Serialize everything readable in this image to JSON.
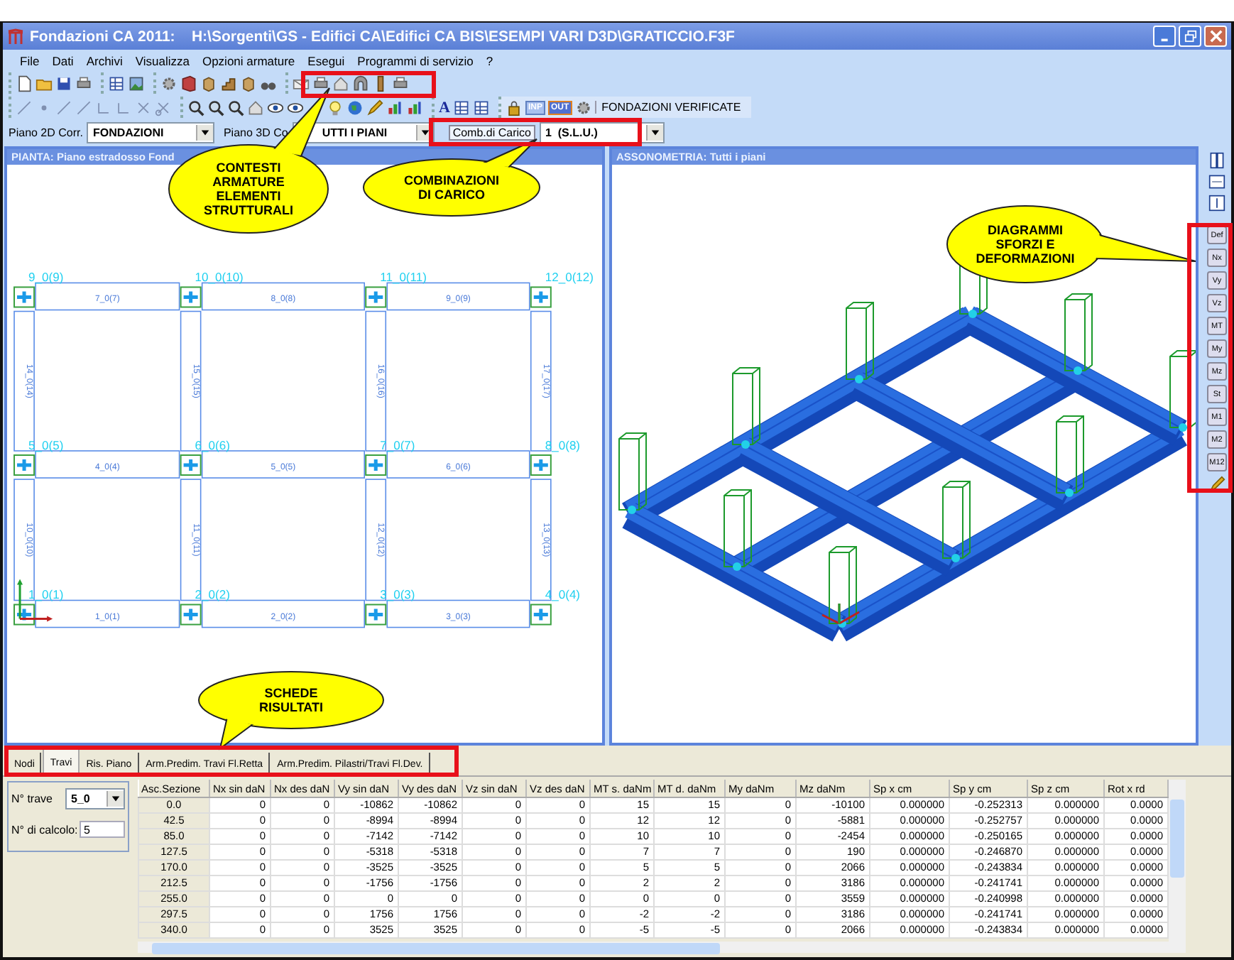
{
  "window": {
    "title": "Fondazioni CA 2011:    H:\\Sorgenti\\GS - Edifici CA\\Edifici CA BIS\\ESEMPI VARI D3D\\GRATICCIO.F3F"
  },
  "menu": [
    "File",
    "Dati",
    "Archivi",
    "Visualizza",
    "Opzioni armature",
    "Esegui",
    "Programmi di servizio",
    "?"
  ],
  "toolbar": {
    "glyph": "A",
    "toggles": [
      {
        "label": "INP",
        "pressed": false
      },
      {
        "label": "OUT",
        "pressed": true
      }
    ],
    "verified_button": "FONDAZIONI VERIFICATE"
  },
  "selectors": [
    {
      "label": "Piano 2D Corr.",
      "value": "FONDAZIONI"
    },
    {
      "label": "Piano 3D Co",
      "value": "UTTI I PIANI"
    },
    {
      "label": "Comb.di Carico",
      "value": "1  (S.L.U.)"
    }
  ],
  "plan": {
    "title": "PIANTA: Piano estradosso Fond",
    "node_labels": [
      "9_0(9)",
      "10_0(10)",
      "11_0(11)",
      "12_0(12)",
      "5_0(5)",
      "6_0(6)",
      "7_0(7)",
      "8_0(8)",
      "1_0(1)",
      "2_0(2)",
      "3_0(3)",
      "4_0(4)"
    ],
    "horizontal_beam_labels": [
      "7_0(7)",
      "8_0(8)",
      "9_0(9)",
      "4_0(4)",
      "5_0(5)",
      "6_0(6)",
      "1_0(1)",
      "2_0(2)",
      "3_0(3)"
    ],
    "vertical_beam_labels": [
      "14_0(14)",
      "15_0(15)",
      "16_0(16)",
      "17_0(17)",
      "10_0(10)",
      "11_0(11)",
      "12_0(12)",
      "13_0(13)"
    ]
  },
  "axonometry": {
    "title": "ASSONOMETRIA: Tutti i piani"
  },
  "side_toolbar": [
    "Def",
    "Nx",
    "Vy",
    "Vz",
    "MT",
    "My",
    "Mz",
    "St",
    "M1",
    "M2",
    "M12"
  ],
  "tabs": [
    {
      "label": "Nodi",
      "selected": false
    },
    {
      "label": "Travi",
      "selected": true
    },
    {
      "label": "Ris. Piano",
      "selected": false
    },
    {
      "label": "Arm.Predim. Travi Fl.Retta",
      "selected": false
    },
    {
      "label": "Arm.Predim. Pilastri/Travi Fl.Dev.",
      "selected": false
    }
  ],
  "beam_form": {
    "beam_label": "N° trave",
    "beam_value": "5_0",
    "calc_label": "N° di calcolo:",
    "calc_value": "5"
  },
  "table": {
    "columns": [
      "Asc.Sezione",
      "Nx sin daN",
      "Nx des daN",
      "Vy sin daN",
      "Vy des daN",
      "Vz sin daN",
      "Vz des daN",
      "MT s. daNm",
      "MT d. daNm",
      "My daNm",
      "Mz daNm",
      "Sp x cm",
      "Sp y cm",
      "Sp z cm",
      "Rot x rd"
    ],
    "rows": [
      [
        "0.0",
        "0",
        "0",
        "-10862",
        "-10862",
        "0",
        "0",
        "15",
        "15",
        "0",
        "-10100",
        "0.000000",
        "-0.252313",
        "0.000000",
        "0.0000"
      ],
      [
        "42.5",
        "0",
        "0",
        "-8994",
        "-8994",
        "0",
        "0",
        "12",
        "12",
        "0",
        "-5881",
        "0.000000",
        "-0.252757",
        "0.000000",
        "0.0000"
      ],
      [
        "85.0",
        "0",
        "0",
        "-7142",
        "-7142",
        "0",
        "0",
        "10",
        "10",
        "0",
        "-2454",
        "0.000000",
        "-0.250165",
        "0.000000",
        "0.0000"
      ],
      [
        "127.5",
        "0",
        "0",
        "-5318",
        "-5318",
        "0",
        "0",
        "7",
        "7",
        "0",
        "190",
        "0.000000",
        "-0.246870",
        "0.000000",
        "0.0000"
      ],
      [
        "170.0",
        "0",
        "0",
        "-3525",
        "-3525",
        "0",
        "0",
        "5",
        "5",
        "0",
        "2066",
        "0.000000",
        "-0.243834",
        "0.000000",
        "0.0000"
      ],
      [
        "212.5",
        "0",
        "0",
        "-1756",
        "-1756",
        "0",
        "0",
        "2",
        "2",
        "0",
        "3186",
        "0.000000",
        "-0.241741",
        "0.000000",
        "0.0000"
      ],
      [
        "255.0",
        "0",
        "0",
        "0",
        "0",
        "0",
        "0",
        "0",
        "0",
        "0",
        "3559",
        "0.000000",
        "-0.240998",
        "0.000000",
        "0.0000"
      ],
      [
        "297.5",
        "0",
        "0",
        "1756",
        "1756",
        "0",
        "0",
        "-2",
        "-2",
        "0",
        "3186",
        "0.000000",
        "-0.241741",
        "0.000000",
        "0.0000"
      ],
      [
        "340.0",
        "0",
        "0",
        "3525",
        "3525",
        "0",
        "0",
        "-5",
        "-5",
        "0",
        "2066",
        "0.000000",
        "-0.243834",
        "0.000000",
        "0.0000"
      ]
    ]
  },
  "callouts": [
    {
      "text": "CONTESTI\nARMATURE\nELEMENTI\nSTRUTTURALI"
    },
    {
      "text": "COMBINAZIONI\nDI  CARICO"
    },
    {
      "text": "DIAGRAMMI\nSFORZI  E\nDEFORMAZIONI"
    },
    {
      "text": "SCHEDE\nRISULTATI"
    }
  ]
}
